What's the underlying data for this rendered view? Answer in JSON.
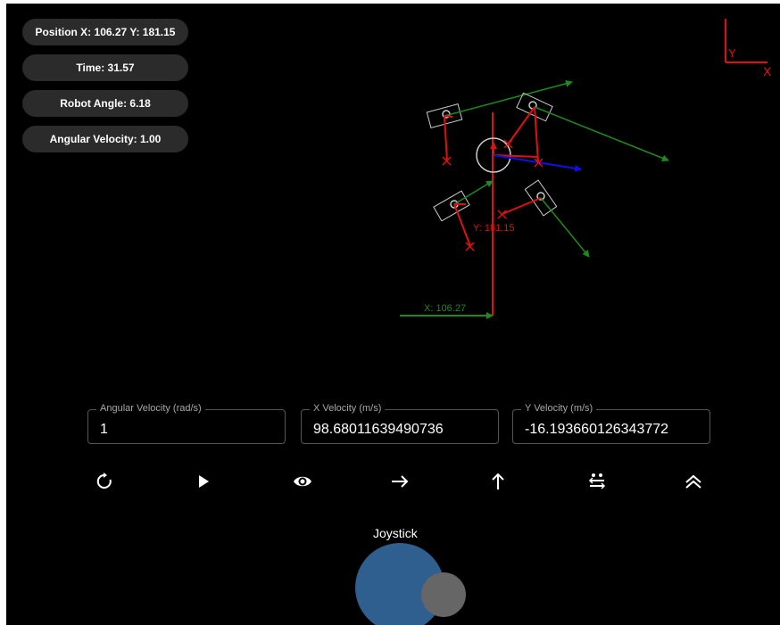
{
  "telemetry": {
    "position": "Position X: 106.27 Y: 181.15",
    "time": "Time: 31.57",
    "robot_angle": "Robot Angle: 6.18",
    "angular_velocity": "Angular Velocity: 1.00"
  },
  "canvas": {
    "frame_y_label": "Y",
    "frame_x_label": "X",
    "x_readout": "X: 106.27",
    "y_readout": "Y: 181.15",
    "colors": {
      "x_axis": "#1e8a1e",
      "y_axis": "#e01010",
      "heading": "#1010e0",
      "frame": "#e01010",
      "wheel_outline": "#cccccc"
    }
  },
  "inputs": {
    "angular_velocity": {
      "label": "Angular Velocity (rad/s)",
      "value": "1"
    },
    "x_velocity": {
      "label": "X Velocity (m/s)",
      "value": "98.68011639490736"
    },
    "y_velocity": {
      "label": "Y Velocity (m/s)",
      "value": "-16.193660126343772"
    }
  },
  "toolbar": {
    "icons": [
      "reset-icon",
      "play-icon",
      "eye-icon",
      "arrow-right-icon",
      "arrow-up-icon",
      "swap-icon",
      "double-chevron-up-icon"
    ]
  },
  "joystick": {
    "title": "Joystick",
    "base_color": "#2e5f8f",
    "knob_color": "#666666"
  }
}
